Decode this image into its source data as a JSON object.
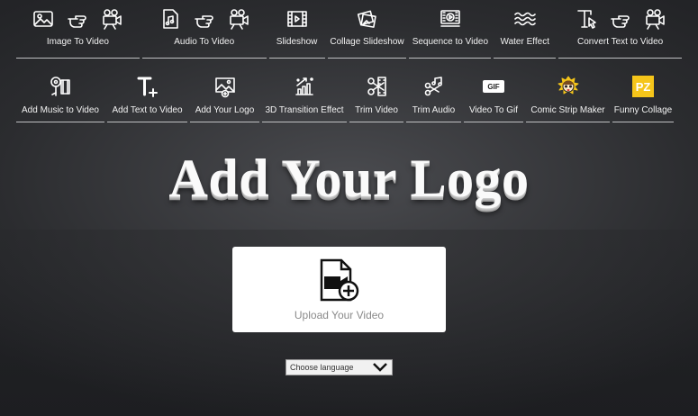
{
  "tools_row1": [
    {
      "label": "Image To Video",
      "icons": [
        "image-icon",
        "hand-pointer-icon",
        "video-camera-icon"
      ]
    },
    {
      "label": "Audio To Video",
      "icons": [
        "audio-file-icon",
        "hand-pointer-icon",
        "video-camera-icon"
      ]
    },
    {
      "label": "Slideshow",
      "icons": [
        "film-strip-icon"
      ]
    },
    {
      "label": "Collage Slideshow",
      "icons": [
        "collage-photos-icon"
      ]
    },
    {
      "label": "Sequence to Video",
      "icons": [
        "video-player-icon"
      ]
    },
    {
      "label": "Water Effect",
      "icons": [
        "water-waves-icon"
      ]
    },
    {
      "label": "Convert Text to Video",
      "icons": [
        "text-cursor-icon",
        "hand-pointer-icon",
        "video-camera-icon"
      ]
    }
  ],
  "tools_row2": [
    {
      "label": "Add Music to Video",
      "icons": [
        "music-film-icon"
      ]
    },
    {
      "label": "Add Text to Video",
      "icons": [
        "text-plus-icon"
      ]
    },
    {
      "label": "Add Your Logo",
      "icons": [
        "image-add-icon"
      ]
    },
    {
      "label": "3D Transition Effect",
      "icons": [
        "3d-transition-icon"
      ]
    },
    {
      "label": "Trim Video",
      "icons": [
        "scissors-film-icon"
      ]
    },
    {
      "label": "Trim Audio",
      "icons": [
        "scissors-music-icon"
      ]
    },
    {
      "label": "Video To Gif",
      "icons": [
        "gif-icon"
      ],
      "badge": "GIF"
    },
    {
      "label": "Comic Strip Maker",
      "icons": [
        "comic-face-icon"
      ]
    },
    {
      "label": "Funny Collage",
      "icons": [
        "pz-logo-icon"
      ],
      "badge": "PZ"
    }
  ],
  "hero": {
    "title": "Add Your Logo"
  },
  "upload": {
    "label": "Upload Your Video"
  },
  "language": {
    "selected": "Choose language"
  },
  "colors": {
    "background": "#2a2b2e",
    "badge_yellow": "#f5c51a",
    "panel": "#ffffff"
  }
}
